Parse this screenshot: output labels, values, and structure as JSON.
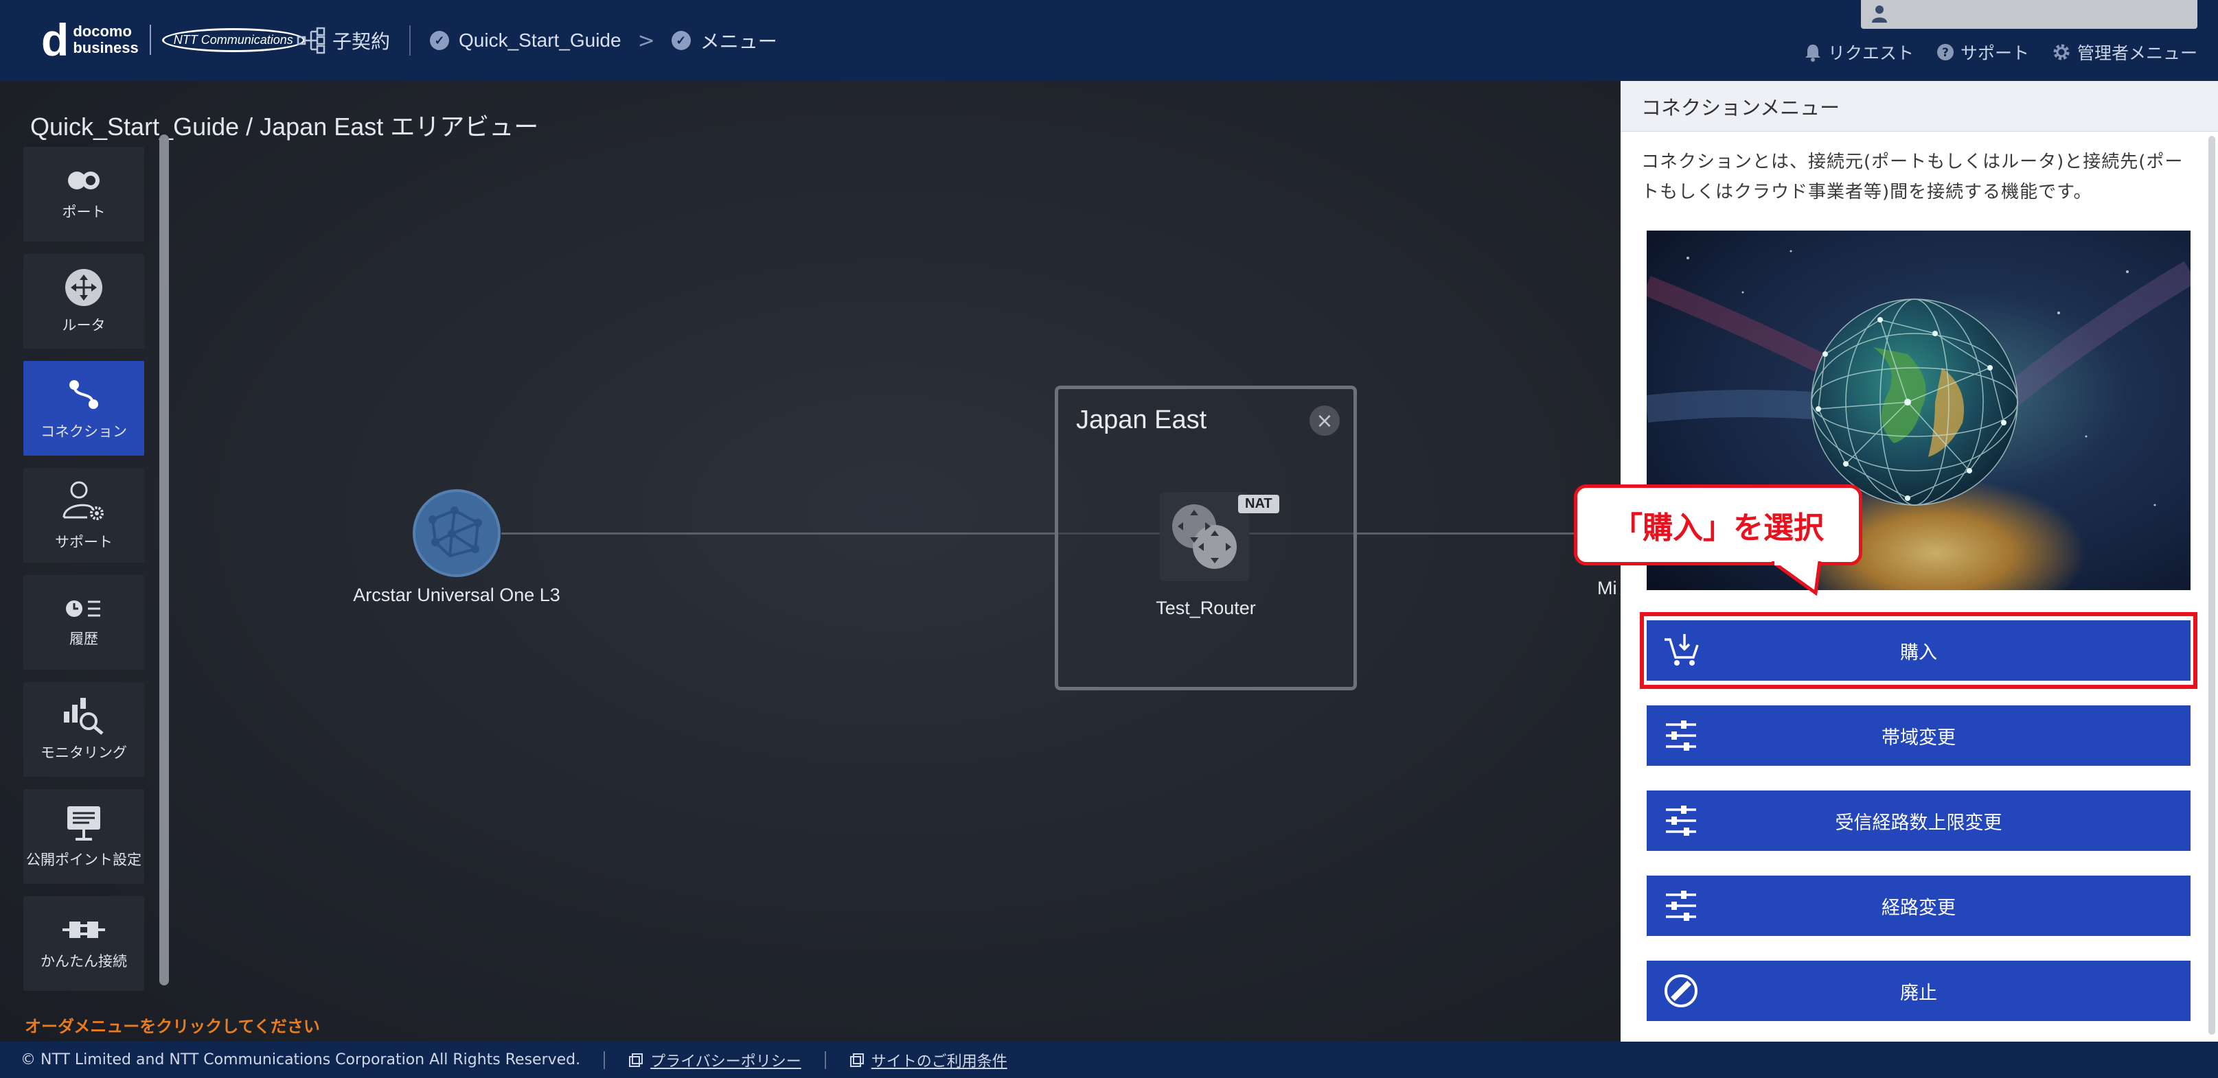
{
  "header": {
    "logo_line1": "docomo",
    "logo_line2": "business",
    "logo_ntt": "NTT Communications",
    "nav_subcontract": "子契約",
    "nav_guide": "Quick_Start_Guide",
    "nav_menu": "メニュー",
    "util_request": "リクエスト",
    "util_support": "サポート",
    "util_admin": "管理者メニュー"
  },
  "canvas": {
    "breadcrumb": "Quick_Start_Guide / Japan East エリアビュー",
    "hint": "オーダメニューをクリックしてください",
    "node_l3": "Arcstar Universal One L3",
    "area_title": "Japan East",
    "area_close": "×",
    "router_badge": "NAT",
    "router_label": "Test_Router",
    "cut_label": "Mi"
  },
  "sidebar": {
    "items": [
      {
        "label": "ポート",
        "icon": "port-icon"
      },
      {
        "label": "ルータ",
        "icon": "router-icon"
      },
      {
        "label": "コネクション",
        "icon": "connection-icon"
      },
      {
        "label": "サポート",
        "icon": "support-icon"
      },
      {
        "label": "履歴",
        "icon": "history-icon"
      },
      {
        "label": "モニタリング",
        "icon": "monitoring-icon"
      },
      {
        "label": "公開ポイント設定",
        "icon": "public-point-icon"
      },
      {
        "label": "かんたん接続",
        "icon": "easy-connect-icon"
      }
    ],
    "active": "コネクション"
  },
  "panel": {
    "title": "コネクションメニュー",
    "description": "コネクションとは、接続元(ポートもしくはルータ)と接続先(ポートもしくはクラウド事業者等)間を接続する機能です。",
    "buttons": [
      {
        "label": "購入",
        "icon": "cart-icon"
      },
      {
        "label": "帯域変更",
        "icon": "sliders-icon"
      },
      {
        "label": "受信経路数上限変更",
        "icon": "sliders-icon"
      },
      {
        "label": "経路変更",
        "icon": "sliders-icon"
      },
      {
        "label": "廃止",
        "icon": "prohibited-icon"
      }
    ],
    "callout": "「購入」を選択"
  },
  "footer": {
    "copyright": "© NTT Limited and NTT Communications Corporation All Rights Reserved.",
    "privacy": "プライバシーポリシー",
    "terms": "サイトのご利用条件"
  },
  "colors": {
    "header_bg": "#0f2650",
    "accent_blue": "#2346ba",
    "highlight_red": "#e8121f",
    "hint_orange": "#e87c1e"
  }
}
